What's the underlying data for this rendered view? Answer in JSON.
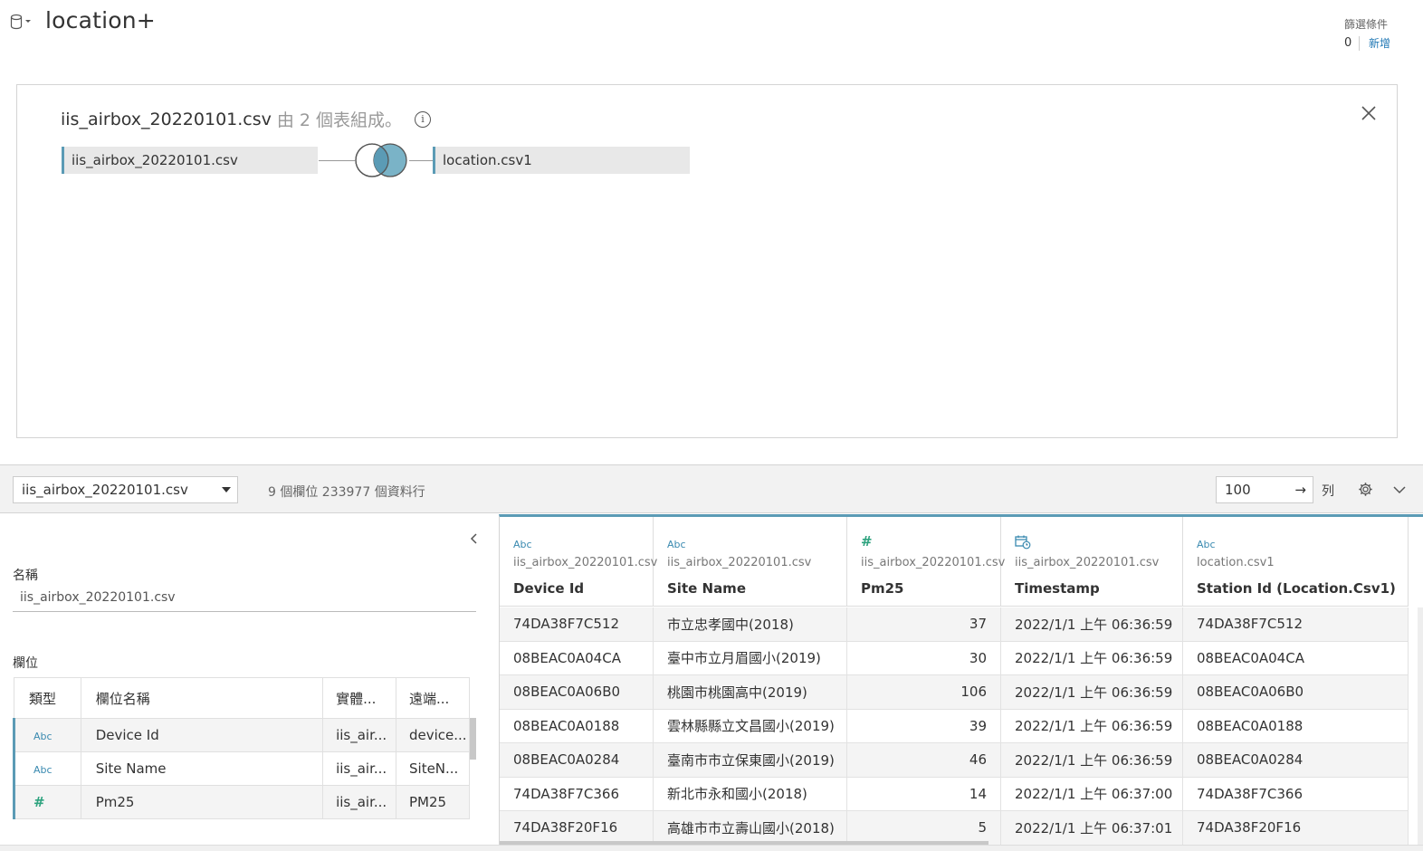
{
  "header": {
    "title": "location+",
    "filters_label": "篩選條件",
    "filters_count": "0",
    "filters_add": "新增"
  },
  "canvas": {
    "title_main": "iis_airbox_20220101.csv",
    "title_sub": "由 2 個表組成。",
    "left_table": "iis_airbox_20220101.csv",
    "right_table": "location.csv1"
  },
  "toolbar": {
    "table_select": "iis_airbox_20220101.csv",
    "stats": "9 個欄位 233977 個資料行",
    "rows_value": "100",
    "rows_unit": "列"
  },
  "meta": {
    "name_label": "名稱",
    "name_value": "iis_airbox_20220101.csv",
    "fields_label": "欄位",
    "headers": [
      "類型",
      "欄位名稱",
      "實體...",
      "遠端..."
    ],
    "rows": [
      {
        "type": "Abc",
        "name": "Device Id",
        "physical": "iis_air...",
        "remote": "device..."
      },
      {
        "type": "#",
        "name": "Site Name",
        "physical": "iis_air...",
        "remote": "SiteN..."
      },
      {
        "type": "#",
        "name": "Pm25",
        "physical": "iis_air...",
        "remote": "PM25"
      }
    ]
  },
  "grid": {
    "columns": [
      {
        "type": "Abc",
        "source": "iis_airbox_20220101.csv",
        "name": "Device Id"
      },
      {
        "type": "Abc",
        "source": "iis_airbox_20220101.csv",
        "name": "Site Name"
      },
      {
        "type": "#",
        "source": "iis_airbox_20220101.csv",
        "name": "Pm25"
      },
      {
        "type": "date-icon",
        "source": "iis_airbox_20220101.csv",
        "name": "Timestamp"
      },
      {
        "type": "Abc",
        "source": "location.csv1",
        "name": "Station Id (Location.Csv1)"
      }
    ],
    "rows": [
      [
        "74DA38F7C512",
        "市立忠孝國中(2018)",
        "37",
        "2022/1/1 上午 06:36:59",
        "74DA38F7C512"
      ],
      [
        "08BEAC0A04CA",
        "臺中市立月眉國小(2019)",
        "30",
        "2022/1/1 上午 06:36:59",
        "08BEAC0A04CA"
      ],
      [
        "08BEAC0A06B0",
        "桃園市桃園高中(2019)",
        "106",
        "2022/1/1 上午 06:36:59",
        "08BEAC0A06B0"
      ],
      [
        "08BEAC0A0188",
        "雲林縣縣立文昌國小(2019)",
        "39",
        "2022/1/1 上午 06:36:59",
        "08BEAC0A0188"
      ],
      [
        "08BEAC0A0284",
        "臺南市市立保東國小(2019)",
        "46",
        "2022/1/1 上午 06:36:59",
        "08BEAC0A0284"
      ],
      [
        "74DA38F7C366",
        "新北市永和國小(2018)",
        "14",
        "2022/1/1 上午 06:37:00",
        "74DA38F7C366"
      ],
      [
        "74DA38F20F16",
        "高雄市市立壽山國小(2018)",
        "5",
        "2022/1/1 上午 06:37:01",
        "74DA38F20F16"
      ]
    ]
  }
}
